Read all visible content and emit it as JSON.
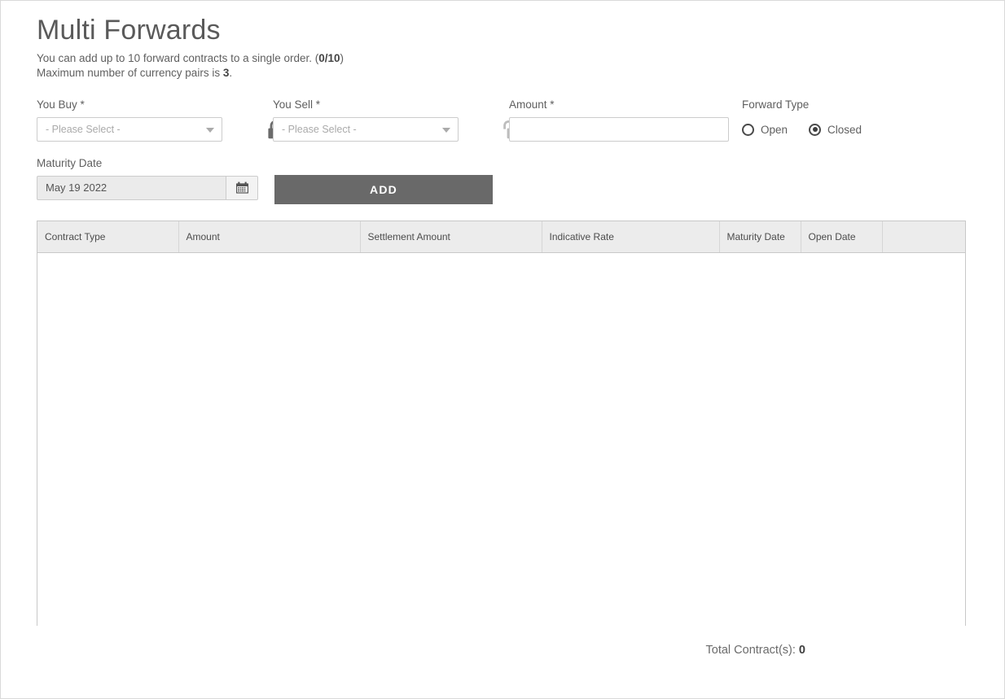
{
  "page": {
    "title": "Multi Forwards",
    "subtitle_line1_pre": "You can add up to 10 forward contracts to a single order. (",
    "subtitle_line1_count": "0/10",
    "subtitle_line1_post": ")",
    "subtitle_line2_pre": "Maximum number of currency pairs is ",
    "subtitle_line2_value": "3",
    "subtitle_line2_post": "."
  },
  "form": {
    "you_buy": {
      "label": "You Buy *",
      "value": "- Please Select -",
      "lock_icon": "lock-closed-icon",
      "lock_state": "closed"
    },
    "you_sell": {
      "label": "You Sell *",
      "value": "- Please Select -",
      "lock_icon": "lock-open-icon",
      "lock_state": "open"
    },
    "amount": {
      "label": "Amount *",
      "value": "",
      "placeholder": ""
    },
    "forward_type": {
      "label": "Forward Type",
      "options": [
        {
          "label": "Open",
          "selected": false
        },
        {
          "label": "Closed",
          "selected": true
        }
      ]
    },
    "maturity_date": {
      "label": "Maturity Date",
      "value": "May 19 2022",
      "calendar_icon": "calendar-icon"
    },
    "add_button": "ADD"
  },
  "table": {
    "columns": [
      "Contract Type",
      "Amount",
      "Settlement Amount",
      "Indicative Rate",
      "Maturity Date",
      "Open Date",
      ""
    ],
    "rows": []
  },
  "footer": {
    "total_label": "Total Contract(s): ",
    "total_value": "0"
  },
  "colors": {
    "button": "#696969",
    "header_bg": "#ececec",
    "lock_closed": "#6b6b6b",
    "lock_open": "#bdbdbd",
    "border": "#c8c8c8"
  }
}
